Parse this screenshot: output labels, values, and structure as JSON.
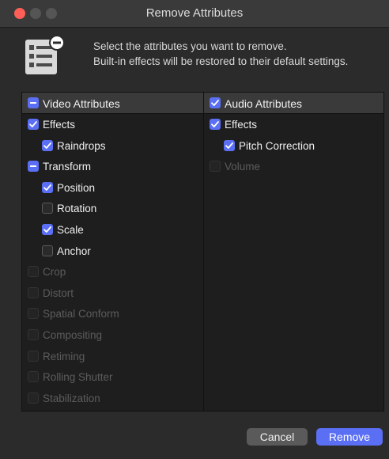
{
  "window": {
    "title": "Remove Attributes"
  },
  "message": {
    "line1": "Select the attributes you want to remove.",
    "line2": "Built-in effects will be restored to their default settings."
  },
  "video": {
    "header": "Video Attributes",
    "header_state": "mixed",
    "items": [
      {
        "label": "Effects",
        "state": "checked",
        "level": 0,
        "enabled": true
      },
      {
        "label": "Raindrops",
        "state": "checked",
        "level": 1,
        "enabled": true
      },
      {
        "label": "Transform",
        "state": "mixed",
        "level": 0,
        "enabled": true
      },
      {
        "label": "Position",
        "state": "checked",
        "level": 1,
        "enabled": true
      },
      {
        "label": "Rotation",
        "state": "unchecked",
        "level": 1,
        "enabled": true
      },
      {
        "label": "Scale",
        "state": "checked",
        "level": 1,
        "enabled": true
      },
      {
        "label": "Anchor",
        "state": "unchecked",
        "level": 1,
        "enabled": true
      },
      {
        "label": "Crop",
        "state": "unchecked",
        "level": 0,
        "enabled": false
      },
      {
        "label": "Distort",
        "state": "unchecked",
        "level": 0,
        "enabled": false
      },
      {
        "label": "Spatial Conform",
        "state": "unchecked",
        "level": 0,
        "enabled": false
      },
      {
        "label": "Compositing",
        "state": "unchecked",
        "level": 0,
        "enabled": false
      },
      {
        "label": "Retiming",
        "state": "unchecked",
        "level": 0,
        "enabled": false
      },
      {
        "label": "Rolling Shutter",
        "state": "unchecked",
        "level": 0,
        "enabled": false
      },
      {
        "label": "Stabilization",
        "state": "unchecked",
        "level": 0,
        "enabled": false
      }
    ]
  },
  "audio": {
    "header": "Audio Attributes",
    "header_state": "checked",
    "items": [
      {
        "label": "Effects",
        "state": "checked",
        "level": 0,
        "enabled": true
      },
      {
        "label": "Pitch Correction",
        "state": "checked",
        "level": 1,
        "enabled": true
      },
      {
        "label": "Volume",
        "state": "unchecked",
        "level": 0,
        "enabled": false
      }
    ]
  },
  "buttons": {
    "cancel": "Cancel",
    "remove": "Remove"
  },
  "colors": {
    "accent": "#5b6ff5",
    "close": "#ff5f57"
  },
  "icons": {
    "header": "list-remove-icon",
    "check": "checkmark-icon",
    "mixed": "dash-icon"
  }
}
